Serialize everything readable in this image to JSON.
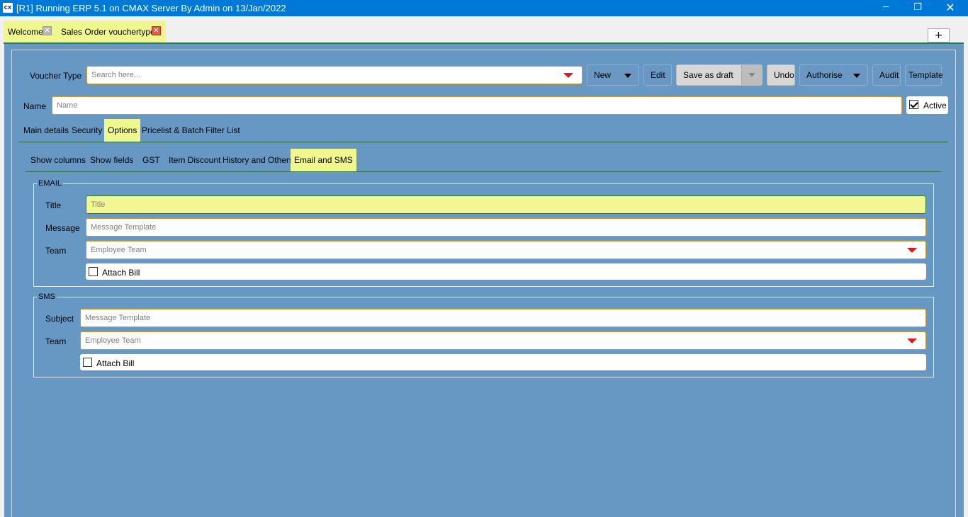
{
  "window": {
    "title": "[R1] Running ERP 5.1 on CMAX Server By Admin on 13/Jan/2022",
    "app_icon_text": "CX",
    "minimize_glyph": "─",
    "maximize_glyph": "❐",
    "close_glyph": "✕"
  },
  "doc_tabs": {
    "items": [
      {
        "label": "Welcome",
        "close": "✕"
      },
      {
        "label": "Sales Order vouchertype",
        "close": "✕"
      }
    ],
    "add_label": "+"
  },
  "toolbar": {
    "voucher_type_label": "Voucher Type",
    "voucher_type_placeholder": "Search here...",
    "new_label": "New",
    "edit_label": "Edit",
    "save_draft_label": "Save as draft",
    "undo_label": "Undo",
    "authorise_label": "Authorise",
    "audit_label": "Audit",
    "template_label": "Template"
  },
  "name_row": {
    "label": "Name",
    "placeholder": "Name",
    "active_label": "Active",
    "active_checked": true
  },
  "main_tabs": [
    {
      "label": "Main details"
    },
    {
      "label": "Security"
    },
    {
      "label": "Options"
    },
    {
      "label": "Pricelist & Batch"
    },
    {
      "label": "Filter List"
    }
  ],
  "sub_tabs": [
    {
      "label": "Show columns"
    },
    {
      "label": "Show fields"
    },
    {
      "label": "GST"
    },
    {
      "label": "Item Discount"
    },
    {
      "label": "History and Others"
    },
    {
      "label": "Email and SMS"
    }
  ],
  "email": {
    "legend": "EMAIL",
    "title_label": "Title",
    "title_placeholder": "Title",
    "message_label": "Message",
    "message_placeholder": "Message Template",
    "team_label": "Team",
    "team_placeholder": "Employee Team",
    "attach_label": "Attach Bill",
    "attach_checked": false
  },
  "sms": {
    "legend": "SMS",
    "subject_label": "Subject",
    "subject_placeholder": "Message Template",
    "team_label": "Team",
    "team_placeholder": "Employee Team",
    "attach_label": "Attach Bill",
    "attach_checked": false
  },
  "colors": {
    "titlebar": "#0078d7",
    "panel": "#6798c4",
    "highlight": "#f1f78f",
    "dropdown_arrow": "#d91b1b",
    "field_border": "#d49a26",
    "focus_border": "#2b7d2b"
  }
}
